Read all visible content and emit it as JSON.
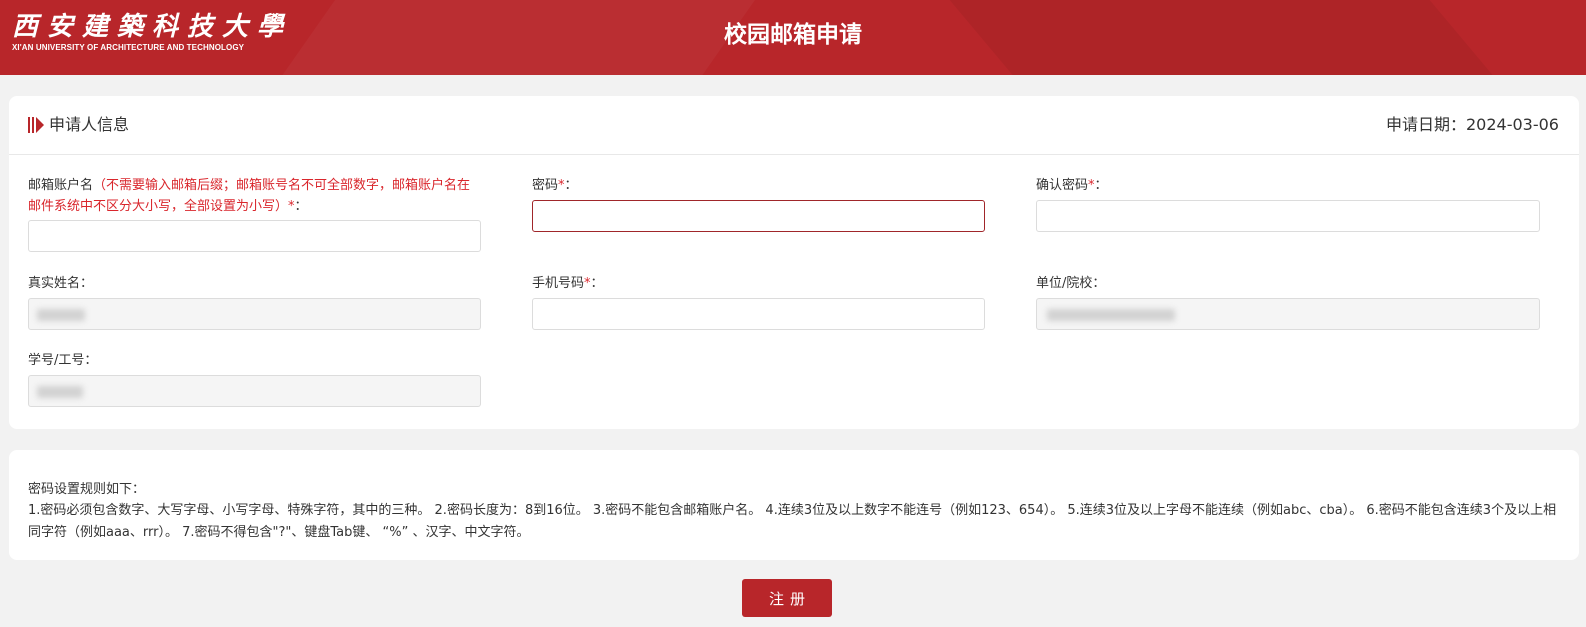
{
  "header": {
    "logo_cn": "西安建築科技大學",
    "logo_en": "XI'AN UNIVERSITY OF ARCHITECTURE AND TECHNOLOGY",
    "title": "校园邮箱申请"
  },
  "info": {
    "section_title": "申请人信息",
    "apply_date": "申请日期：2024-03-06",
    "fields": {
      "account": {
        "label": "邮箱账户名",
        "hint": "（不需要输入邮箱后缀；邮箱账号名不可全部数字，邮箱账户名在邮件系统中不区分大小写，全部设置为小写）",
        "req": "*",
        "colon": "：",
        "value": ""
      },
      "password": {
        "label": "密码",
        "req": "*",
        "colon": "：",
        "value": ""
      },
      "confirm": {
        "label": "确认密码",
        "req": "*",
        "colon": "：",
        "value": ""
      },
      "realname": {
        "label": "真实姓名",
        "colon": "："
      },
      "phone": {
        "label": "手机号码",
        "req": "*",
        "colon": "：",
        "value": ""
      },
      "unit": {
        "label": "单位/院校",
        "colon": "："
      },
      "studentid": {
        "label": "学号/工号",
        "colon": "："
      }
    }
  },
  "rules": {
    "title": "密码设置规则如下：",
    "text": "1.密码必须包含数字、大写字母、小写字母、特殊字符，其中的三种。 2.密码长度为：8到16位。 3.密码不能包含邮箱账户名。 4.连续3位及以上数字不能连号（例如123、654）。 5.连续3位及以上字母不能连续（例如abc、cba）。 6.密码不能包含连续3个及以上相同字符（例如aaa、rrr）。 7.密码不得包含\"?\"、键盘Tab键、 “%” 、汉字、中文字符。"
  },
  "register_label": "注册",
  "colors": {
    "brand_red": "#b8262a",
    "required_red": "#d9262c",
    "focus_border": "#a0262a"
  }
}
